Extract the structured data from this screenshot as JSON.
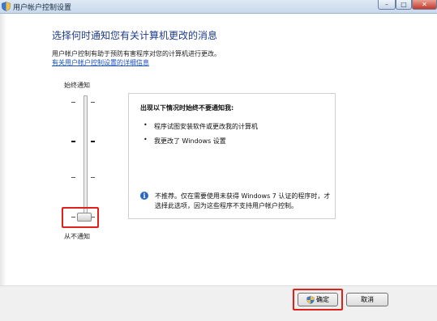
{
  "window": {
    "title": "用户帐户控制设置",
    "icon": "uac-shield-icon",
    "controls": {
      "minimize": "–",
      "maximize": "□",
      "close": "✕"
    }
  },
  "content": {
    "heading": "选择何时通知您有关计算机更改的消息",
    "description": "用户帐户控制有助于预防有害程序对您的计算机进行更改。",
    "link": "有关用户帐户控制设置的详细信息"
  },
  "slider": {
    "top_label": "始终通知",
    "bottom_label": "从不通知",
    "levels": 4,
    "selected_level": 1
  },
  "panel": {
    "title": "出现以下情况时始终不要通知我:",
    "bullets": [
      "程序试图安装软件或更改我的计算机",
      "我更改了 Windows 设置"
    ],
    "note": "不推荐。仅在需要使用未获得 Windows 7 认证的程序时，才选择此选项，因为这些程序不支持用户帐户控制。",
    "note_icon": "info-icon"
  },
  "buttons": {
    "ok": "确定",
    "cancel": "取消"
  },
  "colors": {
    "heading": "#1e3c8c",
    "link": "#1a4fbf",
    "highlight": "#e0201a"
  }
}
